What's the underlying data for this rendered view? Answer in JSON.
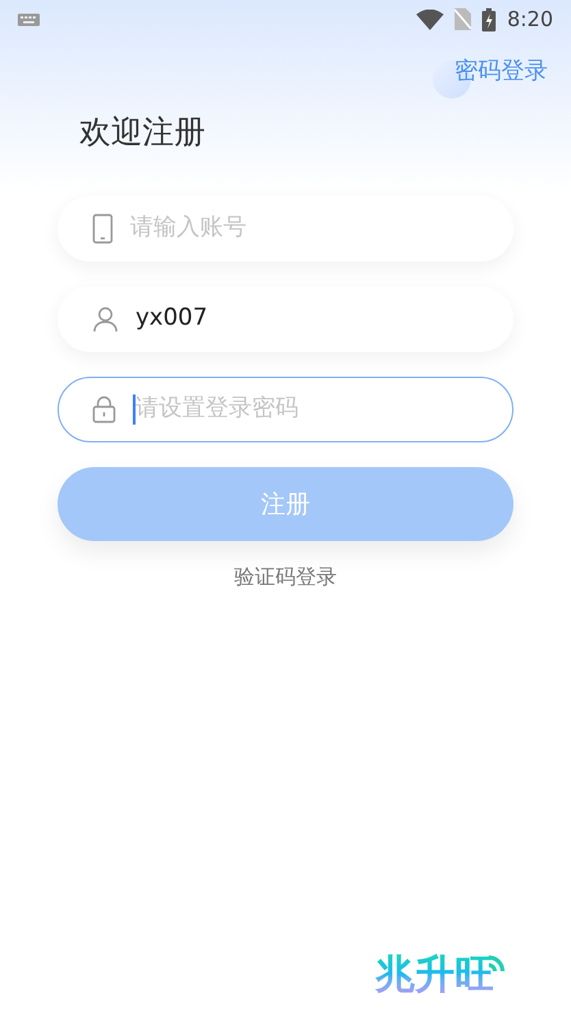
{
  "status_bar": {
    "time": "8:20"
  },
  "top_link": "密码登录",
  "title": "欢迎注册",
  "fields": [
    {
      "kind": "phone",
      "placeholder": "请输入账号",
      "focused": false
    },
    {
      "kind": "user",
      "value": "yx007",
      "focused": false
    },
    {
      "kind": "lock",
      "placeholder": "请设置登录密码",
      "focused": true
    }
  ],
  "register_button": {
    "label": "注册",
    "disabled": true
  },
  "alt_link": "验证码登录",
  "logo": "兆升旺"
}
